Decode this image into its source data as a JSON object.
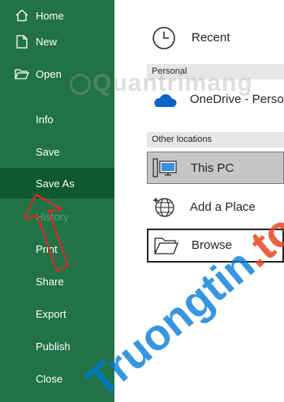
{
  "sidebar": {
    "items": [
      {
        "label": "Home",
        "icon": "home-icon"
      },
      {
        "label": "New",
        "icon": "new-document-icon"
      },
      {
        "label": "Open",
        "icon": "open-folder-icon"
      },
      {
        "label": "Info"
      },
      {
        "label": "Save"
      },
      {
        "label": "Save As",
        "selected": true
      },
      {
        "label": "History",
        "disabled": true
      },
      {
        "label": "Print"
      },
      {
        "label": "Share"
      },
      {
        "label": "Export"
      },
      {
        "label": "Publish"
      },
      {
        "label": "Close"
      }
    ]
  },
  "content": {
    "recent_label": "Recent",
    "personal_header": "Personal",
    "onedrive_label": "OneDrive - Personal",
    "other_header": "Other locations",
    "this_pc_label": "This PC",
    "add_place_label": "Add a Place",
    "browse_label": "Browse"
  },
  "watermark": {
    "top_text": "Quantrimang",
    "bottom_text_main": "Truongtin",
    "bottom_text_dot": ".top"
  },
  "colors": {
    "sidebar_bg": "#217346",
    "selected_bg": "#0e5a2e",
    "arrow": "#d62a2a",
    "onedrive": "#0a64c8"
  }
}
